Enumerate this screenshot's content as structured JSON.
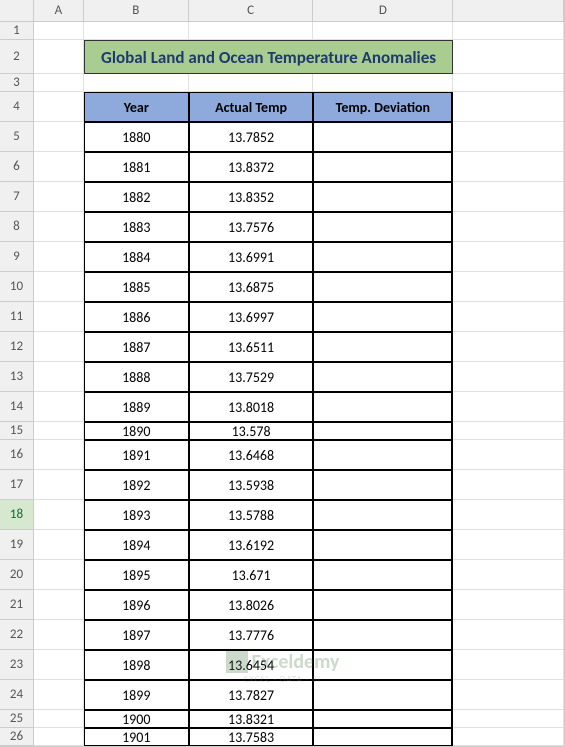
{
  "columns": [
    "A",
    "B",
    "C",
    "D",
    ""
  ],
  "title": "Global Land and Ocean Temperature Anomalies",
  "selected_row": 18,
  "headers": {
    "year": "Year",
    "actual": "Actual Temp",
    "deviation": "Temp. Deviation"
  },
  "rows": [
    {
      "num": 1,
      "h": "h-small"
    },
    {
      "num": 2,
      "h": "h-title",
      "title": true
    },
    {
      "num": 3,
      "h": "h-small"
    },
    {
      "num": 4,
      "h": "h-normal",
      "header": true
    },
    {
      "num": 5,
      "h": "h-normal",
      "year": "1880",
      "temp": "13.7852"
    },
    {
      "num": 6,
      "h": "h-normal",
      "year": "1881",
      "temp": "13.8372"
    },
    {
      "num": 7,
      "h": "h-normal",
      "year": "1882",
      "temp": "13.8352"
    },
    {
      "num": 8,
      "h": "h-normal",
      "year": "1883",
      "temp": "13.7576"
    },
    {
      "num": 9,
      "h": "h-normal",
      "year": "1884",
      "temp": "13.6991"
    },
    {
      "num": 10,
      "h": "h-normal",
      "year": "1885",
      "temp": "13.6875"
    },
    {
      "num": 11,
      "h": "h-normal",
      "year": "1886",
      "temp": "13.6997"
    },
    {
      "num": 12,
      "h": "h-normal",
      "year": "1887",
      "temp": "13.6511"
    },
    {
      "num": 13,
      "h": "h-normal",
      "year": "1888",
      "temp": "13.7529"
    },
    {
      "num": 14,
      "h": "h-normal",
      "year": "1889",
      "temp": "13.8018"
    },
    {
      "num": 15,
      "h": "h-small",
      "year": "1890",
      "temp": "13.578"
    },
    {
      "num": 16,
      "h": "h-normal",
      "year": "1891",
      "temp": "13.6468"
    },
    {
      "num": 17,
      "h": "h-normal",
      "year": "1892",
      "temp": "13.5938"
    },
    {
      "num": 18,
      "h": "h-normal",
      "year": "1893",
      "temp": "13.5788"
    },
    {
      "num": 19,
      "h": "h-normal",
      "year": "1894",
      "temp": "13.6192"
    },
    {
      "num": 20,
      "h": "h-normal",
      "year": "1895",
      "temp": "13.671"
    },
    {
      "num": 21,
      "h": "h-normal",
      "year": "1896",
      "temp": "13.8026"
    },
    {
      "num": 22,
      "h": "h-normal",
      "year": "1897",
      "temp": "13.7776"
    },
    {
      "num": 23,
      "h": "h-normal",
      "year": "1898",
      "temp": "13.6454"
    },
    {
      "num": 24,
      "h": "h-normal",
      "year": "1899",
      "temp": "13.7827"
    },
    {
      "num": 25,
      "h": "h-small",
      "year": "1900",
      "temp": "13.8321"
    },
    {
      "num": 26,
      "h": "h-small",
      "year": "1901",
      "temp": "13.7583"
    }
  ],
  "watermark": {
    "main": "Exceldemy",
    "sub": "EXCEL · DATA · BI"
  }
}
